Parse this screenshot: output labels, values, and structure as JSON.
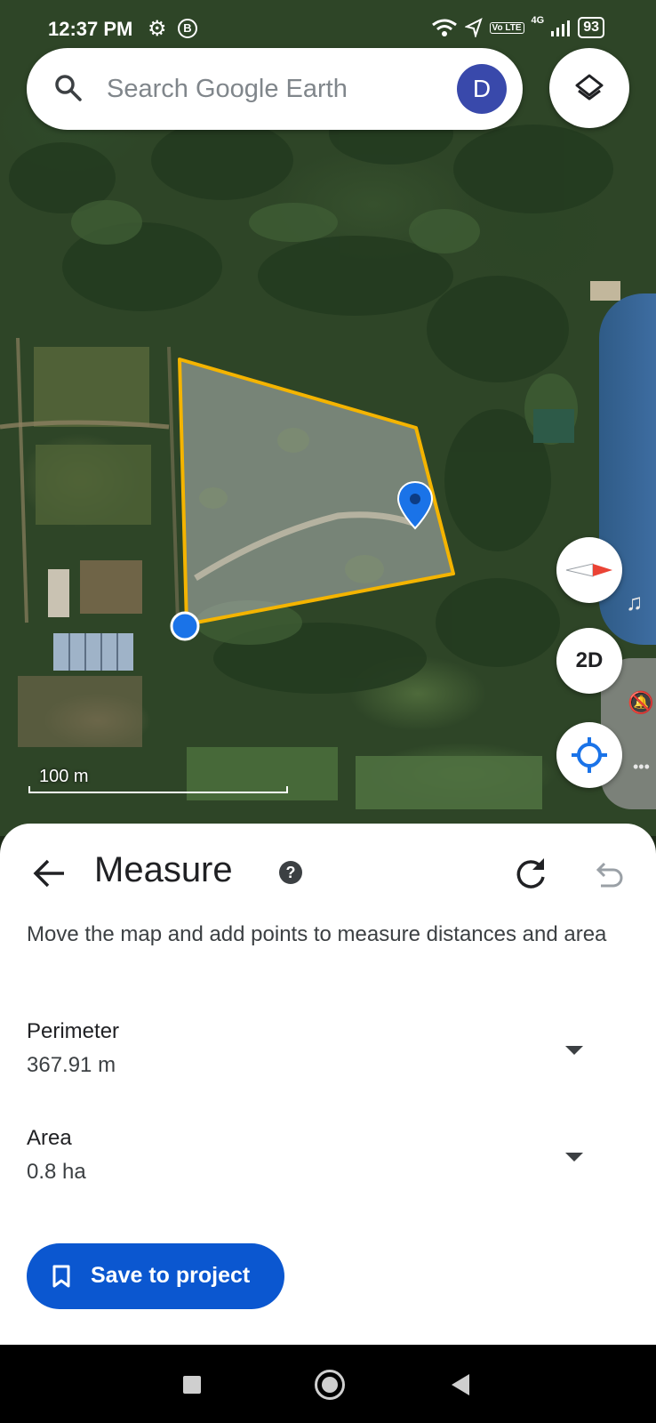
{
  "status_bar": {
    "time": "12:37 PM",
    "badge": "B",
    "network_label": "4G",
    "volte_label": "Vo LTE",
    "battery": "93"
  },
  "search": {
    "placeholder": "Search Google Earth",
    "avatar_letter": "D"
  },
  "map": {
    "scale_label": "100 m",
    "view_mode_label": "2D",
    "measure_shape_color": "#f4b400",
    "point_color": "#1a73e8"
  },
  "sheet": {
    "title": "Measure",
    "help_glyph": "?",
    "description": "Move the map and add points to measure distances and area",
    "perimeter_label": "Perimeter",
    "perimeter_value": "367.91 m",
    "area_label": "Area",
    "area_value": "0.8 ha",
    "save_label": "Save to project"
  },
  "colors": {
    "primary_button": "#0b57d0",
    "avatar": "#3949ab"
  }
}
